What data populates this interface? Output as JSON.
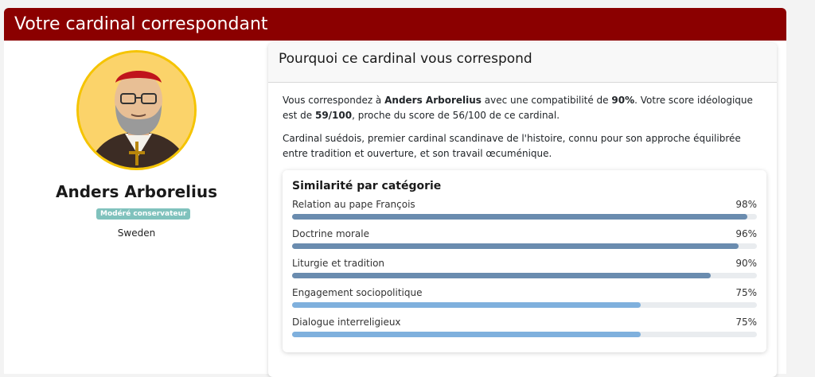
{
  "header": {
    "title": "Votre cardinal correspondant"
  },
  "profile": {
    "name": "Anders Arborelius",
    "badge": "Modéré conservateur",
    "country": "Sweden",
    "avatar_icon": "cardinal-portrait"
  },
  "why": {
    "title": "Pourquoi ce cardinal vous correspond",
    "p1_a": "Vous correspondez à ",
    "p1_name": "Anders Arborelius",
    "p1_b": " avec une compatibilité de ",
    "p1_pct": "90%",
    "p1_c": ". Votre score idéologique est de ",
    "p1_score": "59/100",
    "p1_d": ", proche du score de 56/100 de ce cardinal.",
    "p2": "Cardinal suédois, premier cardinal scandinave de l'histoire, connu pour son approche équilibrée entre tradition et ouverture, et son travail œcuménique."
  },
  "similarity": {
    "title": "Similarité par catégorie",
    "items": [
      {
        "label": "Relation au pape François",
        "value_text": "98%",
        "value": 98,
        "color": "#6a8caf"
      },
      {
        "label": "Doctrine morale",
        "value_text": "96%",
        "value": 96,
        "color": "#6a8caf"
      },
      {
        "label": "Liturgie et tradition",
        "value_text": "90%",
        "value": 90,
        "color": "#6a8caf"
      },
      {
        "label": "Engagement sociopolitique",
        "value_text": "75%",
        "value": 75,
        "color": "#7fb0dd"
      },
      {
        "label": "Dialogue interreligieux",
        "value_text": "75%",
        "value": 75,
        "color": "#7fb0dd"
      }
    ]
  }
}
